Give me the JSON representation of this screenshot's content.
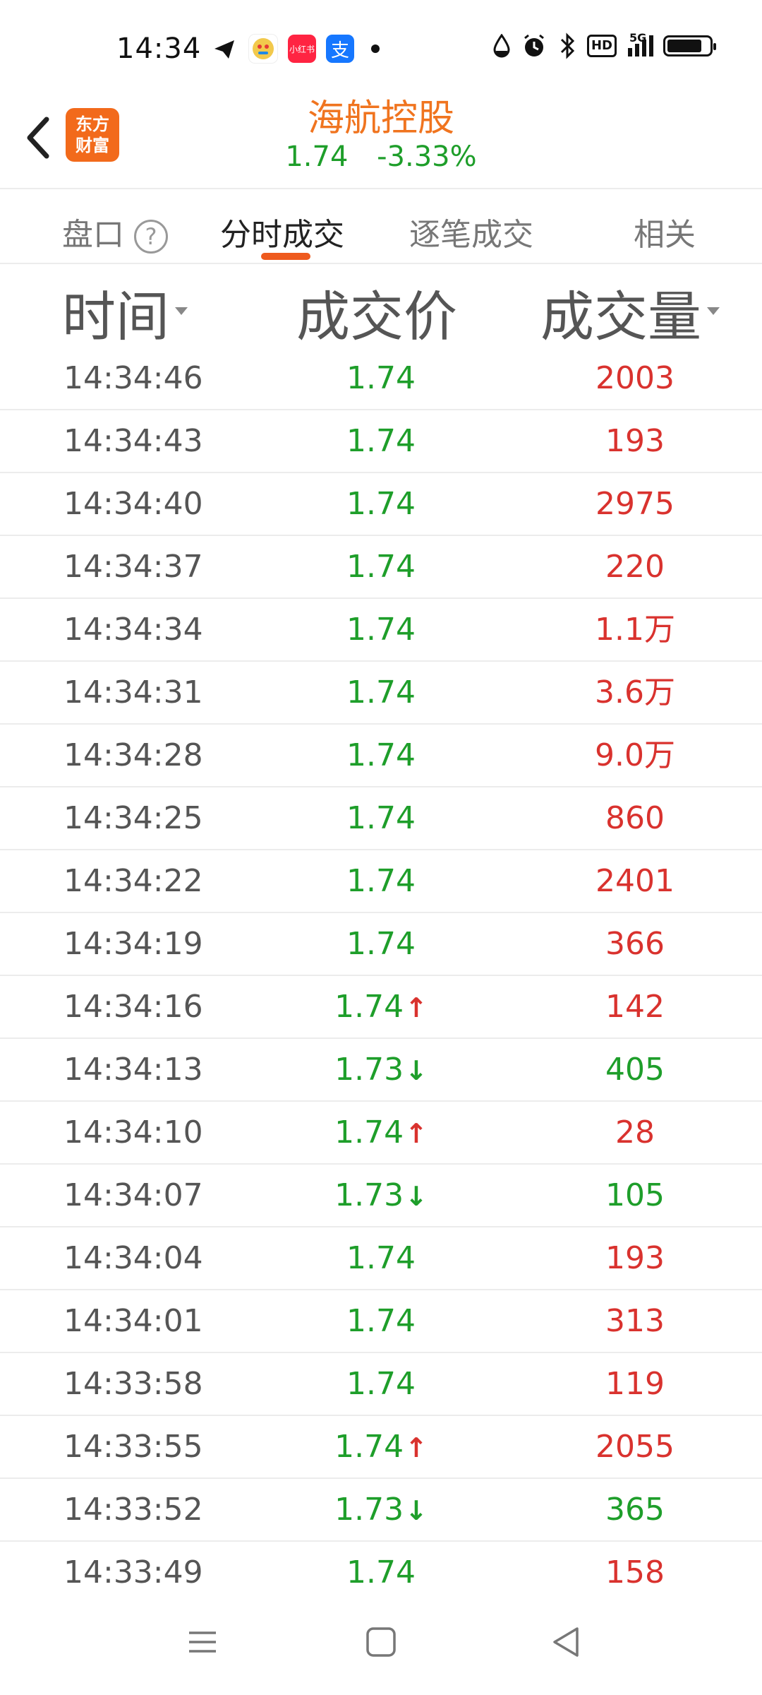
{
  "status_bar": {
    "time": "14:34",
    "app_icons": [
      {
        "name": "telegram-like-icon",
        "label": ""
      },
      {
        "name": "mascot-app-icon",
        "label": ""
      },
      {
        "name": "xiaohongshu-icon",
        "label": "小红书"
      },
      {
        "name": "alipay-icon",
        "label": "支"
      }
    ],
    "right_icons": [
      "water-drop-icon",
      "alarm-icon",
      "bluetooth-icon",
      "hd-icon",
      "5g-signal-icon",
      "battery-icon"
    ],
    "hd_label": "HD",
    "network_label": "5G"
  },
  "header": {
    "logo_line1": "东方",
    "logo_line2": "财富",
    "stock_name": "海航控股",
    "price": "1.74",
    "change_pct": "-3.33%"
  },
  "tabs": [
    {
      "label": "盘口",
      "active": false
    },
    {
      "label": "分时成交",
      "active": true
    },
    {
      "label": "逐笔成交",
      "active": false
    },
    {
      "label": "相关",
      "active": false
    }
  ],
  "help_icon_label": "?",
  "columns": {
    "time": "时间",
    "price": "成交价",
    "volume": "成交量"
  },
  "rows": [
    {
      "time": "14:34:46",
      "price": "1.74",
      "arrow": "",
      "volume": "2003",
      "vol_color": "red"
    },
    {
      "time": "14:34:43",
      "price": "1.74",
      "arrow": "",
      "volume": "193",
      "vol_color": "red"
    },
    {
      "time": "14:34:40",
      "price": "1.74",
      "arrow": "",
      "volume": "2975",
      "vol_color": "red"
    },
    {
      "time": "14:34:37",
      "price": "1.74",
      "arrow": "",
      "volume": "220",
      "vol_color": "red"
    },
    {
      "time": "14:34:34",
      "price": "1.74",
      "arrow": "",
      "volume": "1.1万",
      "vol_color": "red"
    },
    {
      "time": "14:34:31",
      "price": "1.74",
      "arrow": "",
      "volume": "3.6万",
      "vol_color": "red"
    },
    {
      "time": "14:34:28",
      "price": "1.74",
      "arrow": "",
      "volume": "9.0万",
      "vol_color": "red"
    },
    {
      "time": "14:34:25",
      "price": "1.74",
      "arrow": "",
      "volume": "860",
      "vol_color": "red"
    },
    {
      "time": "14:34:22",
      "price": "1.74",
      "arrow": "",
      "volume": "2401",
      "vol_color": "red"
    },
    {
      "time": "14:34:19",
      "price": "1.74",
      "arrow": "",
      "volume": "366",
      "vol_color": "red"
    },
    {
      "time": "14:34:16",
      "price": "1.74",
      "arrow": "up",
      "volume": "142",
      "vol_color": "red"
    },
    {
      "time": "14:34:13",
      "price": "1.73",
      "arrow": "down",
      "volume": "405",
      "vol_color": "green"
    },
    {
      "time": "14:34:10",
      "price": "1.74",
      "arrow": "up",
      "volume": "28",
      "vol_color": "red"
    },
    {
      "time": "14:34:07",
      "price": "1.73",
      "arrow": "down",
      "volume": "105",
      "vol_color": "green"
    },
    {
      "time": "14:34:04",
      "price": "1.74",
      "arrow": "",
      "volume": "193",
      "vol_color": "red"
    },
    {
      "time": "14:34:01",
      "price": "1.74",
      "arrow": "",
      "volume": "313",
      "vol_color": "red"
    },
    {
      "time": "14:33:58",
      "price": "1.74",
      "arrow": "",
      "volume": "119",
      "vol_color": "red"
    },
    {
      "time": "14:33:55",
      "price": "1.74",
      "arrow": "up",
      "volume": "2055",
      "vol_color": "red"
    },
    {
      "time": "14:33:52",
      "price": "1.73",
      "arrow": "down",
      "volume": "365",
      "vol_color": "green"
    },
    {
      "time": "14:33:49",
      "price": "1.74",
      "arrow": "",
      "volume": "158",
      "vol_color": "red"
    }
  ],
  "colors": {
    "up": "#d9322e",
    "down": "#1e9e2a",
    "accent": "#f0741f"
  },
  "nav_bar": [
    "menu-icon",
    "home-icon",
    "back-triangle-icon"
  ]
}
